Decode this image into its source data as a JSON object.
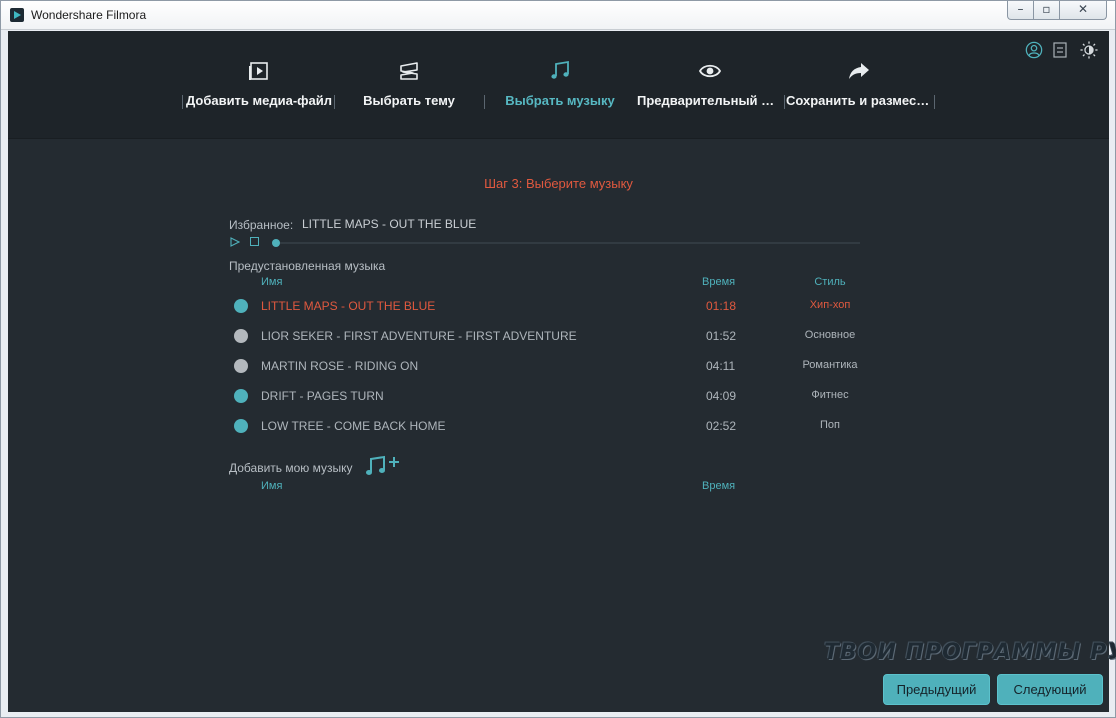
{
  "window": {
    "title": "Wondershare Filmora",
    "minimize_glyph": "–",
    "maximize_glyph": "▫",
    "close_glyph": "✕"
  },
  "steps": [
    {
      "label": "Добавить медиа-файл",
      "icon": "media-file-icon",
      "active": false
    },
    {
      "label": "Выбрать тему",
      "icon": "theme-icon",
      "active": false
    },
    {
      "label": "Выбрать музыку",
      "icon": "music-note-icon",
      "active": true
    },
    {
      "label": "Предварительный просмотр",
      "icon": "eye-icon",
      "active": false
    },
    {
      "label": "Сохранить и разместить",
      "icon": "share-arrow-icon",
      "active": false
    }
  ],
  "header_icons": [
    "user-icon",
    "menu-icon",
    "brightness-icon"
  ],
  "step_title": "Шаг 3: Выберите музыку",
  "favorite": {
    "label": "Избранное:",
    "value": "LITTLE MAPS - OUT THE BLUE",
    "progress": 0
  },
  "preset": {
    "label": "Предустановленная музыка",
    "columns": {
      "name": "Имя",
      "time": "Время",
      "style": "Стиль"
    },
    "tracks": [
      {
        "name": "LITTLE MAPS - OUT THE BLUE",
        "time": "01:18",
        "style": "Хип-хоп",
        "selected": true,
        "downloaded": true
      },
      {
        "name": "LIOR SEKER - FIRST ADVENTURE - FIRST ADVENTURE",
        "time": "01:52",
        "style": "Основное",
        "selected": false,
        "downloaded": false
      },
      {
        "name": "MARTIN ROSE - RIDING ON",
        "time": "04:11",
        "style": "Романтика",
        "selected": false,
        "downloaded": false
      },
      {
        "name": "DRIFT - PAGES TURN",
        "time": "04:09",
        "style": "Фитнес",
        "selected": false,
        "downloaded": true
      },
      {
        "name": "LOW TREE - COME BACK HOME",
        "time": "02:52",
        "style": "Поп",
        "selected": false,
        "downloaded": true
      }
    ]
  },
  "my_music": {
    "label": "Добавить мою музыку",
    "columns": {
      "name": "Имя",
      "time": "Время"
    }
  },
  "watermark": "ТВОИ ПРОГРАММЫ РУ",
  "buttons": {
    "prev": "Предыдущий",
    "next": "Следующий"
  },
  "colors": {
    "accent": "#4fb1bb",
    "selected": "#e0593f",
    "inactive_dot": "#b3b8bd",
    "background": "#242b31",
    "header": "#1e2429"
  }
}
